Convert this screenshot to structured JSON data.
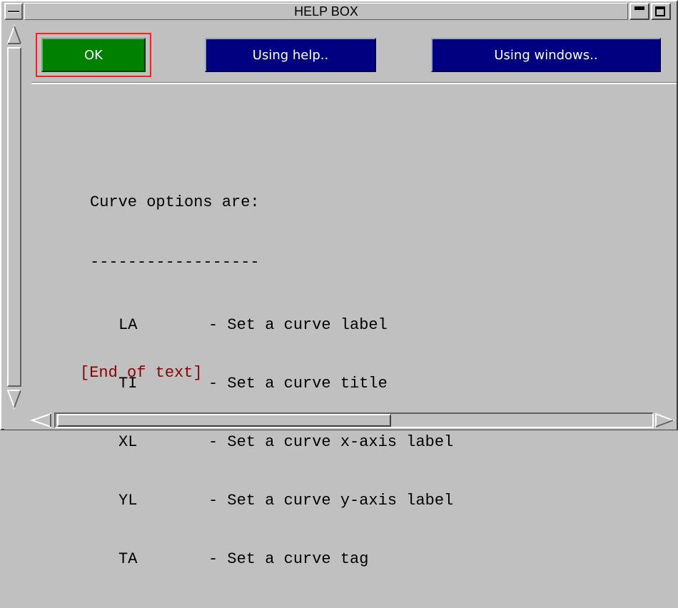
{
  "window": {
    "title": "HELP BOX"
  },
  "buttons": {
    "ok_label": "OK",
    "using_help_label": "Using help..",
    "using_windows_label": "Using windows.."
  },
  "help": {
    "heading": "Curve options are:",
    "underline": "------------------",
    "options": [
      {
        "code": "LA",
        "description": "- Set a curve label"
      },
      {
        "code": "TI",
        "description": "- Set a curve title"
      },
      {
        "code": "XL",
        "description": "- Set a curve x-axis label"
      },
      {
        "code": "YL",
        "description": "- Set a curve y-axis label"
      },
      {
        "code": "TA",
        "description": "- Set a curve tag"
      }
    ],
    "end_text": "[End of text]"
  },
  "icons": {
    "system_menu": "window-menu-icon",
    "minimize": "minimize-icon",
    "maximize": "maximize-icon",
    "scroll_up": "triangle-up-icon",
    "scroll_down": "triangle-down-icon",
    "scroll_left": "triangle-left-icon",
    "scroll_right": "triangle-right-icon"
  },
  "colors": {
    "ok_button": "#008000",
    "nav_button": "#000080",
    "focus_outline": "#ff1e1e",
    "end_text": "#8b0000",
    "background": "#c0c0c0"
  }
}
